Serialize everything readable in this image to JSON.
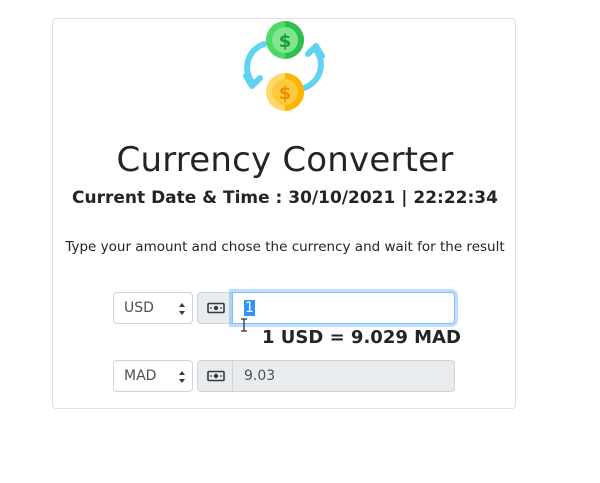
{
  "app": {
    "title": "Currency Converter",
    "datetime": "Current Date & Time : 30/10/2021 | 22:22:34",
    "instruction": "Type your amount and chose the currency and wait for the result"
  },
  "from": {
    "currency": "USD",
    "amount": "1"
  },
  "rate_text": "1 USD = 9.029 MAD",
  "to": {
    "currency": "MAD",
    "result": "9.03"
  },
  "icons": {
    "logo": "currency-exchange-icon",
    "money": "money-bill-icon",
    "select_arrows": "sort-arrows-icon"
  },
  "colors": {
    "focus_border": "#80bdff",
    "addon_bg": "#e9ecef",
    "coin_green": "#4cd964",
    "coin_orange": "#ffb400",
    "arrow_blue": "#5fd3ef"
  }
}
